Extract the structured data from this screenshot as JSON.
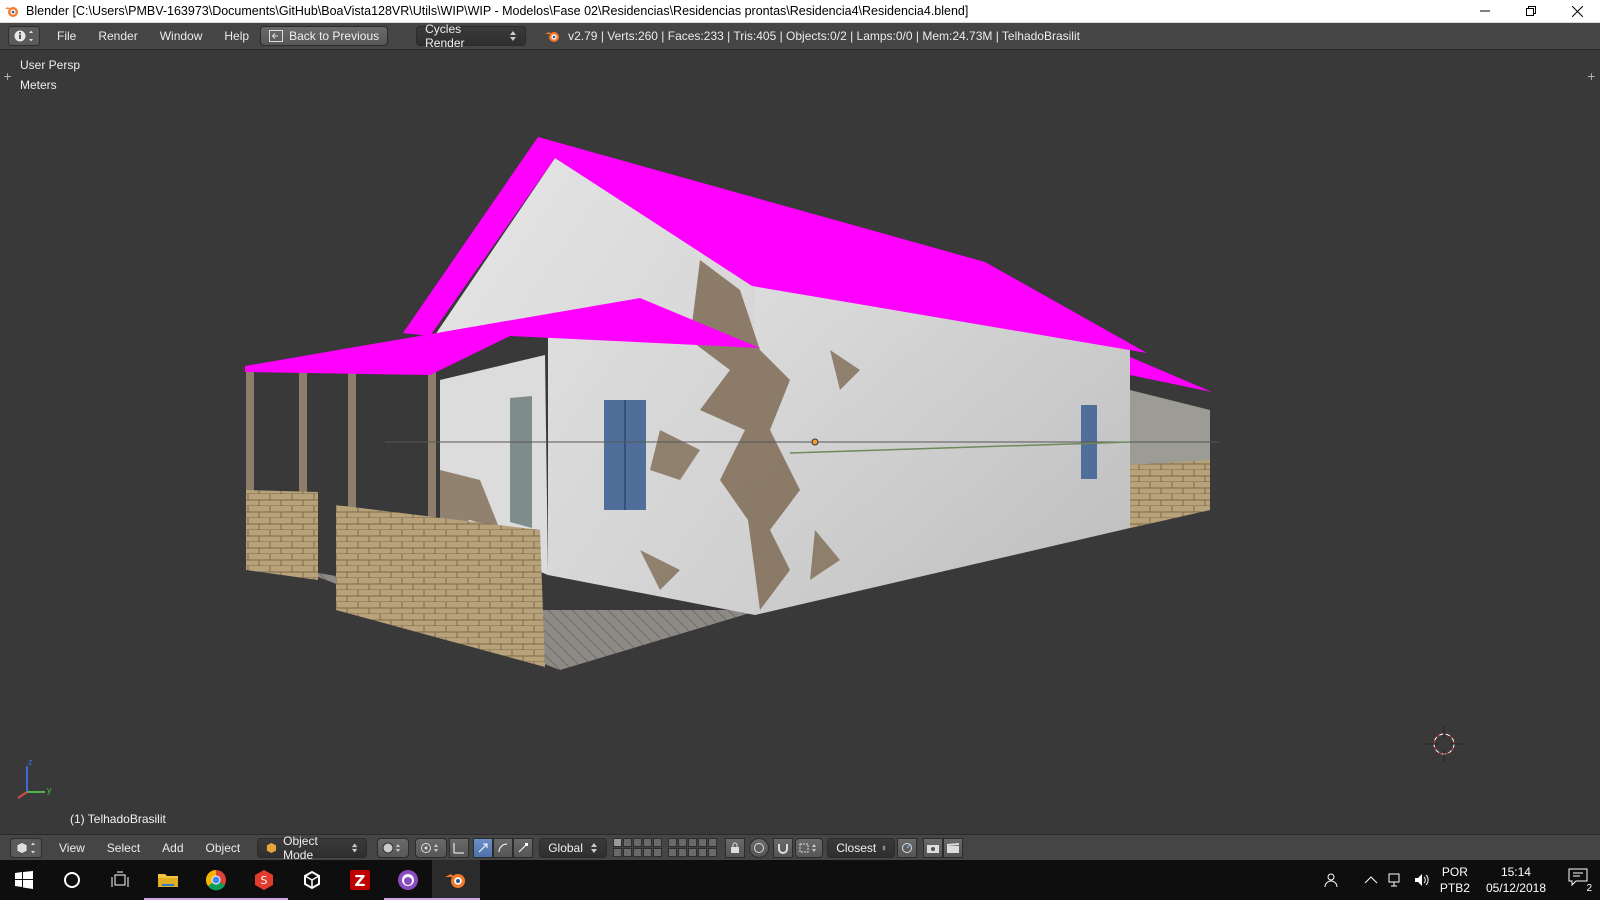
{
  "window": {
    "title": "Blender [C:\\Users\\PMBV-163973\\Documents\\GitHub\\BoaVista128VR\\Utils\\WIP\\WIP - Modelos\\Fase 02\\Residencias\\Residencias prontas\\Residencia4\\Residencia4.blend]"
  },
  "info_header": {
    "menus": [
      "File",
      "Render",
      "Window",
      "Help"
    ],
    "back_button": "Back to Previous",
    "render_engine": "Cycles Render",
    "stats": "v2.79 | Verts:260 | Faces:233 | Tris:405 | Objects:0/2 | Lamps:0/0 | Mem:24.73M | TelhadoBrasilit"
  },
  "viewport": {
    "view_name": "User Persp",
    "units": "Meters",
    "active_object_label": "(1) TelhadoBrasilit",
    "axis_labels": {
      "z": "z",
      "y": "y"
    }
  },
  "view3d_header": {
    "menus": [
      "View",
      "Select",
      "Add",
      "Object"
    ],
    "mode": "Object Mode",
    "orientation": "Global",
    "snap_target": "Closest"
  },
  "taskbar": {
    "apps": [
      "windows-start",
      "cortana",
      "task-view",
      "file-explorer",
      "chrome",
      "sketchup",
      "unity",
      "filezilla",
      "github-desktop",
      "blender"
    ],
    "language_line1": "POR",
    "language_line2": "PTB2",
    "time": "15:14",
    "date": "05/12/2018",
    "notification_count": "2"
  },
  "colors": {
    "roof_magenta": "#ff00ff",
    "viewport_bg": "#393939",
    "header_bg": "#454545",
    "taskbar_bg": "#0e0e0e"
  }
}
